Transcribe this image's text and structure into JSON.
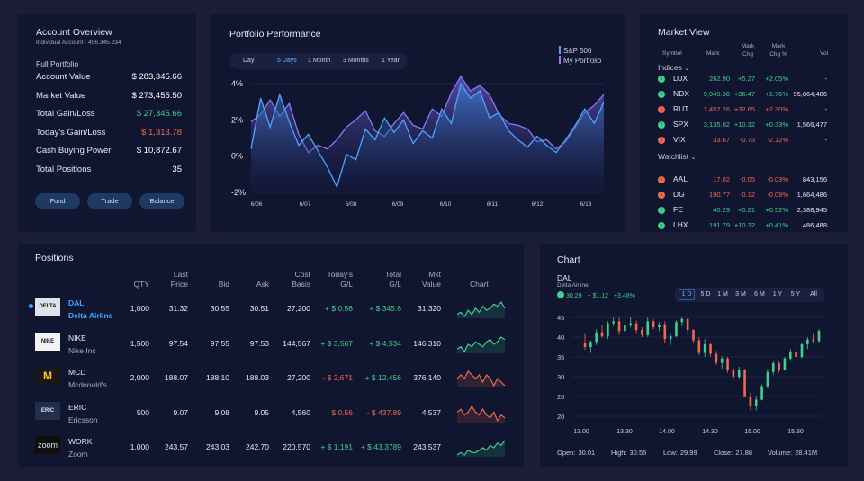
{
  "account": {
    "title": "Account Overview",
    "subtitle": "Individual Account - 456.345.234",
    "section": "Full Portfolio",
    "rows": [
      {
        "label": "Account Value",
        "value": "$ 283,345.66",
        "color": "#ffffff"
      },
      {
        "label": "Market Value",
        "value": "$ 273,455.50",
        "color": "#ffffff"
      },
      {
        "label": "Total Gain/Loss",
        "value": "$ 27,345.66",
        "color": "#3fcf8e"
      },
      {
        "label": "Today's Gain/Loss",
        "value": "$ 1,313.78",
        "color": "#ef6a4c"
      },
      {
        "label": "Cash Buying Power",
        "value": "$ 10,872.67",
        "color": "#ffffff"
      },
      {
        "label": "Total Positions",
        "value": "35",
        "color": "#ffffff"
      }
    ],
    "buttons": [
      "Fund",
      "Trade",
      "Balance"
    ]
  },
  "performance": {
    "title": "Portfolio Performance",
    "tabs": [
      "Day",
      "5 Days",
      "1 Month",
      "3 Months",
      "1 Year"
    ],
    "active_tab": "5 Days",
    "legend": [
      {
        "name": "S&P 500",
        "color": "#4fa3ff"
      },
      {
        "name": "My Portfolio",
        "color": "#8a79f0"
      }
    ]
  },
  "chart_data": [
    {
      "type": "area",
      "title": "Portfolio Performance",
      "x": [
        "6/06",
        "6/07",
        "6/08",
        "6/09",
        "6/10",
        "6/11",
        "6/12",
        "6/13"
      ],
      "yticks": [
        "4%",
        "2%",
        "0%",
        "-2%"
      ],
      "ylim": [
        -2,
        4
      ],
      "grid": true,
      "legend": "top-right",
      "series": [
        {
          "name": "S&P 500",
          "color": "#4fa3ff",
          "values": [
            0.4,
            3.2,
            1.6,
            3.4,
            1.9,
            0.6,
            1.2,
            0.3,
            -0.6,
            -1.7,
            0.1,
            -0.2,
            1.5,
            0.9,
            2.1,
            1.3,
            2.0,
            0.7,
            1.4,
            1.0,
            2.6,
            1.8,
            4.0,
            3.2,
            3.6,
            2.1,
            2.4,
            1.4,
            0.9,
            0.5,
            1.1,
            0.6,
            0.2,
            0.9,
            1.7,
            2.6,
            1.8,
            3.0
          ]
        },
        {
          "name": "My Portfolio",
          "color": "#8a79f0",
          "values": [
            1.9,
            2.3,
            3.1,
            2.2,
            2.9,
            1.2,
            0.2,
            0.6,
            0.4,
            0.9,
            1.6,
            2.0,
            2.5,
            1.4,
            1.1,
            1.8,
            2.4,
            1.7,
            1.5,
            2.6,
            2.2,
            3.5,
            4.4,
            3.6,
            3.9,
            3.4,
            2.3,
            1.8,
            1.7,
            1.5,
            0.8,
            0.9,
            0.4,
            0.8,
            1.6,
            2.4,
            2.8,
            3.4
          ]
        }
      ]
    },
    {
      "type": "candlestick",
      "title": "DAL",
      "x_ticks": [
        "13.00",
        "13.30",
        "14.00",
        "14.30",
        "15.00",
        "15.30"
      ],
      "yticks": [
        "45",
        "40",
        "35",
        "30",
        "25",
        "20"
      ],
      "ylim": [
        20,
        45
      ],
      "grid": true,
      "candles": [
        [
          38.5,
          41.0,
          36.8,
          37.5
        ],
        [
          37.5,
          39.2,
          36.0,
          38.8
        ],
        [
          38.8,
          42.0,
          38.0,
          41.2
        ],
        [
          41.2,
          43.0,
          39.8,
          40.2
        ],
        [
          40.2,
          44.0,
          39.5,
          43.5
        ],
        [
          43.5,
          45.0,
          42.8,
          44.0
        ],
        [
          44.0,
          45.0,
          40.5,
          41.5
        ],
        [
          41.5,
          43.5,
          40.8,
          43.0
        ],
        [
          43.0,
          45.0,
          42.5,
          43.5
        ],
        [
          43.5,
          44.2,
          41.0,
          41.8
        ],
        [
          41.8,
          42.5,
          40.0,
          40.5
        ],
        [
          40.5,
          45.0,
          40.0,
          44.0
        ],
        [
          44.0,
          44.6,
          42.0,
          42.5
        ],
        [
          42.5,
          43.8,
          41.5,
          43.2
        ],
        [
          43.2,
          44.0,
          38.5,
          39.5
        ],
        [
          39.5,
          41.0,
          38.0,
          40.2
        ],
        [
          40.2,
          44.2,
          40.0,
          43.8
        ],
        [
          43.8,
          45.0,
          42.8,
          44.6
        ],
        [
          44.6,
          44.8,
          41.0,
          41.8
        ],
        [
          41.8,
          42.0,
          38.5,
          39.2
        ],
        [
          39.2,
          40.0,
          35.5,
          36.0
        ],
        [
          36.0,
          39.5,
          35.0,
          38.2
        ],
        [
          38.2,
          38.5,
          35.0,
          35.8
        ],
        [
          35.8,
          36.5,
          33.0,
          33.5
        ],
        [
          33.5,
          35.2,
          32.0,
          34.6
        ],
        [
          34.6,
          35.0,
          31.0,
          31.8
        ],
        [
          31.8,
          32.5,
          29.0,
          30.0
        ],
        [
          30.0,
          32.5,
          29.5,
          31.8
        ],
        [
          31.8,
          32.0,
          25.0,
          24.8
        ],
        [
          24.8,
          26.0,
          21.5,
          22.5
        ],
        [
          22.5,
          25.0,
          21.5,
          24.2
        ],
        [
          24.2,
          28.0,
          24.0,
          27.6
        ],
        [
          27.6,
          32.0,
          27.0,
          31.2
        ],
        [
          31.2,
          34.0,
          30.5,
          33.4
        ],
        [
          33.4,
          34.0,
          31.0,
          31.8
        ],
        [
          31.8,
          35.0,
          31.5,
          34.6
        ],
        [
          34.6,
          37.0,
          34.2,
          36.4
        ],
        [
          36.4,
          38.0,
          34.5,
          35.0
        ],
        [
          35.0,
          38.5,
          34.6,
          38.2
        ],
        [
          38.2,
          40.0,
          37.0,
          39.4
        ],
        [
          39.4,
          41.0,
          38.5,
          39.0
        ],
        [
          39.0,
          42.0,
          38.7,
          41.6
        ]
      ],
      "up_color": "#3fcf8e",
      "down_color": "#ef6a4c"
    }
  ],
  "market": {
    "title": "Market View",
    "headers": [
      "Symbol",
      "Mark",
      "Mark Chg",
      "Mark Chg %",
      "Vol"
    ],
    "indices_label": "Indices",
    "watchlist_label": "Watchlist",
    "indices": [
      {
        "sym": "DJX",
        "mark": "262.90",
        "chg": "+5.27",
        "pct": "+2.05%",
        "vol": "-",
        "up": true
      },
      {
        "sym": "NDX",
        "mark": "9,949.36",
        "chg": "+96.47",
        "pct": "+1.76%",
        "vol": "95,864,486",
        "up": true
      },
      {
        "sym": "RUT",
        "mark": "1,452.26",
        "chg": "+32.65",
        "pct": "+2.30%",
        "vol": "-",
        "up": false
      },
      {
        "sym": "SPX",
        "mark": "3,135.02",
        "chg": "+10.32",
        "pct": "+0.33%",
        "vol": "1,566,477",
        "up": true
      },
      {
        "sym": "VIX",
        "mark": "33.67",
        "chg": "-0.73",
        "pct": "-2.12%",
        "vol": "-",
        "up": false
      }
    ],
    "watchlist": [
      {
        "sym": "AAL",
        "mark": "17.02",
        "chg": "-0.05",
        "pct": "-0.03%",
        "vol": "843,156",
        "up": false
      },
      {
        "sym": "DG",
        "mark": "190.77",
        "chg": "-0.12",
        "pct": "-0.09%",
        "vol": "1,664,486",
        "up": false
      },
      {
        "sym": "FE",
        "mark": "40.29",
        "chg": "+0.21",
        "pct": "+0.52%",
        "vol": "2,388,945",
        "up": true
      },
      {
        "sym": "LHX",
        "mark": "191.79",
        "chg": "+10.32",
        "pct": "+0.41%",
        "vol": "486,488",
        "up": true
      }
    ]
  },
  "positions": {
    "title": "Positions",
    "headers": [
      "QTY",
      "Last Price",
      "Bid",
      "Ask",
      "Cost Basis",
      "Today's G/L",
      "Total G/L",
      "Mkt Value",
      "Chart"
    ],
    "rows": [
      {
        "ticker": "DAL",
        "name": "Delta Airline",
        "logo": "DELTA",
        "qty": "1,000",
        "last": "31.32",
        "bid": "30.55",
        "ask": "30.51",
        "cost": "27,200",
        "today": "+ $ 0.56",
        "total": "+ $ 345.6",
        "mkt": "31,320",
        "today_up": true,
        "total_up": true,
        "selected": true,
        "spark": [
          5,
          6,
          4,
          7,
          5,
          8,
          6,
          9,
          7,
          8,
          10,
          9,
          11,
          8
        ]
      },
      {
        "ticker": "NIKE",
        "name": "Nike Inc",
        "logo": "NIKE",
        "qty": "1,500",
        "last": "97.54",
        "bid": "97.55",
        "ask": "97.53",
        "cost": "144,567",
        "today": "+ $ 3,567",
        "total": "+ $ 4,534",
        "mkt": "146,310",
        "today_up": true,
        "total_up": true,
        "selected": false,
        "spark": [
          6,
          7,
          5,
          8,
          7,
          9,
          8,
          7,
          9,
          10,
          8,
          9,
          11,
          10
        ]
      },
      {
        "ticker": "MCD",
        "name": "Mcdonald's",
        "logo": "M",
        "qty": "2,000",
        "last": "188.07",
        "bid": "188.10",
        "ask": "188.03",
        "cost": "27,200",
        "today": "- $ 2,671",
        "total": "+ $ 12,456",
        "mkt": "376,140",
        "today_up": false,
        "total_up": true,
        "selected": false,
        "spark": [
          8,
          9,
          8,
          10,
          9,
          8,
          9,
          7,
          9,
          8,
          6,
          8,
          7,
          6
        ]
      },
      {
        "ticker": "ERIC",
        "name": "Ericsson",
        "logo": "ERIC",
        "qty": "500",
        "last": "9.07",
        "bid": "9.08",
        "ask": "9.05",
        "cost": "4,560",
        "today": "- $ 0.56",
        "total": "- $ 437.89",
        "mkt": "4,537",
        "today_up": false,
        "total_up": false,
        "selected": false,
        "spark": [
          9,
          10,
          8,
          9,
          11,
          9,
          8,
          10,
          8,
          7,
          9,
          6,
          8,
          7
        ]
      },
      {
        "ticker": "WORK",
        "name": "Zoom",
        "logo": "zoom",
        "qty": "1,000",
        "last": "243.57",
        "bid": "243.03",
        "ask": "242.70",
        "cost": "220,570",
        "today": "+ $ 1,191",
        "total": "+ $ 43,3789",
        "mkt": "243,537",
        "today_up": true,
        "total_up": true,
        "selected": false,
        "spark": [
          5,
          6,
          5,
          7,
          6,
          6,
          7,
          8,
          7,
          9,
          8,
          10,
          9,
          11
        ]
      }
    ]
  },
  "chart_panel": {
    "title": "Chart",
    "ticker": "DAL",
    "name": "Delta Airline",
    "price": "30.29",
    "change": "+ $1.12",
    "pct": "+3.48%",
    "ranges": [
      "1 D",
      "5 D",
      "1 M",
      "3 M",
      "6 M",
      "1 Y",
      "5 Y",
      "All"
    ],
    "active_range": "1 D",
    "stats": [
      {
        "label": "Open:",
        "value": "30.01"
      },
      {
        "label": "High:",
        "value": "30.55"
      },
      {
        "label": "Low:",
        "value": "29.99"
      },
      {
        "label": "Close:",
        "value": "27.88"
      },
      {
        "label": "Volume:",
        "value": "28.41M"
      }
    ]
  }
}
